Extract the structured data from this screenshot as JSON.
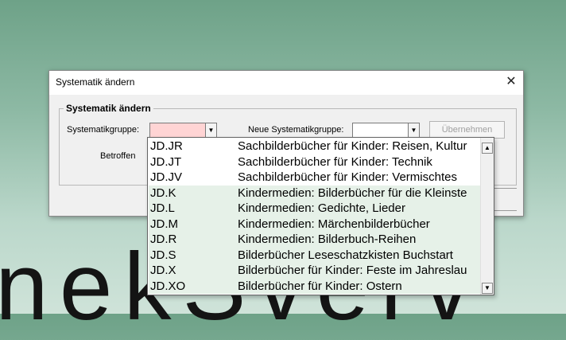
{
  "background": {
    "text": "nekSverv"
  },
  "dialog": {
    "title": "Systematik ändern",
    "close_glyph": "✕",
    "group_title": "Systematik ändern",
    "systematikgruppe_label": "Systematikgruppe:",
    "systematikgruppe_value": "",
    "neue_label": "Neue Systematikgruppe:",
    "neue_value": "",
    "uebernehmen_label": "Übernehmen",
    "betroffen_label": "Betroffen"
  },
  "dropdown": {
    "items": [
      {
        "code": "JD.JR",
        "desc": "Sachbilderbücher für Kinder: Reisen, Kultur"
      },
      {
        "code": "JD.JT",
        "desc": "Sachbilderbücher für Kinder: Technik"
      },
      {
        "code": "JD.JV",
        "desc": "Sachbilderbücher für Kinder: Vermischtes"
      },
      {
        "code": "JD.K",
        "desc": "Kindermedien: Bilderbücher für die Kleinste"
      },
      {
        "code": "JD.L",
        "desc": "Kindermedien: Gedichte, Lieder"
      },
      {
        "code": "JD.M",
        "desc": "Kindermedien: Märchenbilderbücher"
      },
      {
        "code": "JD.R",
        "desc": "Kindermedien: Bilderbuch-Reihen"
      },
      {
        "code": "JD.S",
        "desc": "Bilderbücher Leseschatzkisten Buchstart"
      },
      {
        "code": "JD.X",
        "desc": "Bilderbücher für Kinder: Feste im Jahreslau"
      },
      {
        "code": "JD.XO",
        "desc": "Bilderbücher für Kinder: Ostern"
      }
    ],
    "scroll_up_glyph": "▲",
    "scroll_down_glyph": "▼"
  },
  "colors": {
    "combo_highlight": "#ffd4d4",
    "row_highlight": "#e6f1e8"
  }
}
